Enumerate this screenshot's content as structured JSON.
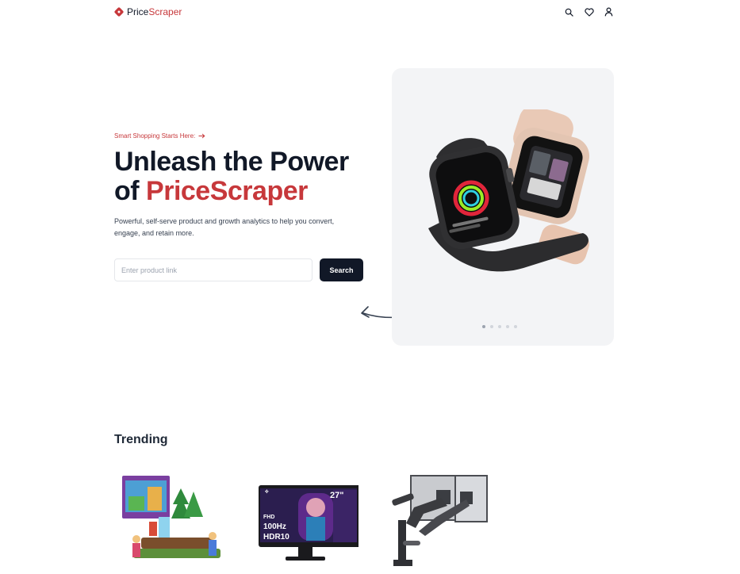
{
  "nav": {
    "brand_part1": "Price",
    "brand_part2": "Scraper",
    "icons": [
      "search-icon",
      "heart-icon",
      "user-icon"
    ]
  },
  "hero": {
    "tagline": "Smart Shopping Starts Here:",
    "headline_line1": "Unleash the Power",
    "headline_line2_prefix": "of ",
    "headline_line2_accent": "PriceScraper",
    "description": "Powerful, self-serve product and growth analytics to help you convert, engage, and retain more.",
    "search_placeholder": "Enter product link",
    "search_button": "Search",
    "carousel": {
      "total": 5,
      "active": 1
    }
  },
  "trending": {
    "title": "Trending",
    "products": [
      {
        "name": "lego-set"
      },
      {
        "name": "monitor",
        "badge_size": "27\"",
        "badge_fhd": "FHD",
        "badge_hz": "100Hz",
        "badge_hdr": "HDR10"
      },
      {
        "name": "monitor-arm"
      }
    ]
  },
  "colors": {
    "accent": "#c7383b",
    "dark": "#111827",
    "card_bg": "#f3f4f6"
  }
}
